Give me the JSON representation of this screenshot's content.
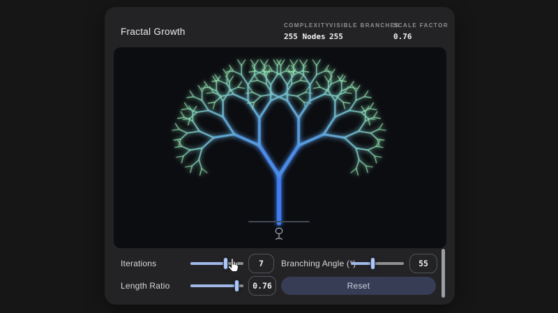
{
  "page": {
    "background": "#161616"
  },
  "card": {
    "background": "#232325"
  },
  "header": {
    "title": "Fractal Growth",
    "stats": [
      {
        "label": "COMPLEXITY",
        "value": "255 Nodes"
      },
      {
        "label": "VISIBLE BRANCHES",
        "value": "255"
      },
      {
        "label": "SCALE FACTOR",
        "value": "0.76"
      }
    ]
  },
  "canvas": {
    "background": "#0c0d11",
    "tree": {
      "iterations": 7,
      "branching_angle_deg": 55,
      "length_ratio": 0.76,
      "trunk_color": "#3f7df2",
      "tip_color": "#98e8b6",
      "node_count": 255
    },
    "ground_icon": "tree-icon"
  },
  "controls": {
    "iterations": {
      "label": "Iterations",
      "value": "7",
      "percent": 67
    },
    "branching_angle": {
      "label": "Branching Angle (°)",
      "value": "55",
      "percent": 42
    },
    "length_ratio": {
      "label": "Length Ratio",
      "value": "0.76",
      "percent": 88
    },
    "reset_label": "Reset"
  },
  "colors": {
    "accent_blue": "#3f7df2",
    "tip_mint": "#98e8b6",
    "slider_fill": "#9fb7e9",
    "slider_track": "#8e9093",
    "slider_thumb": "#aec7f5",
    "reset_bg": "#363d54",
    "ground_line": "#434a56"
  }
}
